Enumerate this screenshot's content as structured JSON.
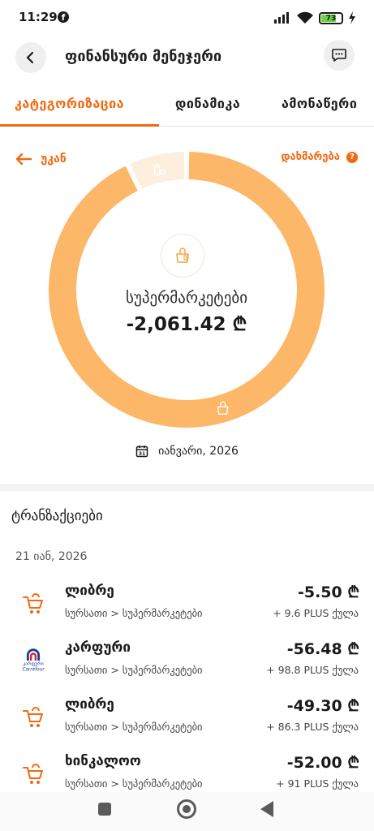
{
  "status_bar": {
    "time": "11:29",
    "fb_glyph": "f",
    "battery_level": "73",
    "battery_fraction": 0.73,
    "icons": [
      "facebook-icon",
      "signal-icon",
      "wifi-icon",
      "battery-icon",
      "charging-icon"
    ]
  },
  "app_bar": {
    "title": "ფინანსური მენეჯერი"
  },
  "tabs": [
    {
      "label": "კატეგორიზაცია",
      "active": true
    },
    {
      "label": "დინამიკა",
      "active": false
    },
    {
      "label": "ამონაწერი",
      "active": false
    }
  ],
  "controls": {
    "back_label": "უკან",
    "help_label": "დახმარება",
    "help_badge": "?"
  },
  "donut": {
    "center_label": "სუპერმარკეტები",
    "center_amount": "-2,061.42 ₾",
    "segments": [
      {
        "category": "supermarkets",
        "icon": "shopping-bag-icon",
        "share": 0.93,
        "color": "#fdb768"
      },
      {
        "category": "pharmacy",
        "icon": "pharmacy-icon",
        "share": 0.07,
        "color": "#fdeedd"
      }
    ]
  },
  "period": {
    "label": "იანვარი, 2026",
    "calendar_day": "31"
  },
  "transactions": {
    "title": "ტრანზაქციები",
    "date_group": "21 იან, 2026",
    "items": [
      {
        "name": "ლიბრე",
        "category": "სურსათი > სუპერმარკეტები",
        "amount": "-5.50 ₾",
        "points": "+ 9.6 PLUS ქულა",
        "logo": "grocery-cart-icon"
      },
      {
        "name": "კარფური",
        "category": "სურსათი > სუპერმარკეტები",
        "amount": "-56.48 ₾",
        "points": "+ 98.8 PLUS ქულა",
        "logo": "carrefour-logo",
        "logo_text": "კარფური",
        "logo_subtext": "Carrefour"
      },
      {
        "name": "ლიბრე",
        "category": "სურსათი > სუპერმარკეტები",
        "amount": "-49.30 ₾",
        "points": "+ 86.3 PLUS ქულა",
        "logo": "grocery-cart-icon"
      },
      {
        "name": "ხინკალოო",
        "category": "სურსათი > სუპერმარკეტები",
        "amount": "-52.00 ₾",
        "points": "+ 91 PLUS ქულა",
        "logo": "grocery-cart-icon"
      }
    ]
  },
  "colors": {
    "accent": "#f06a12",
    "donut_main": "#fdb768",
    "donut_minor": "#fdeedd"
  }
}
